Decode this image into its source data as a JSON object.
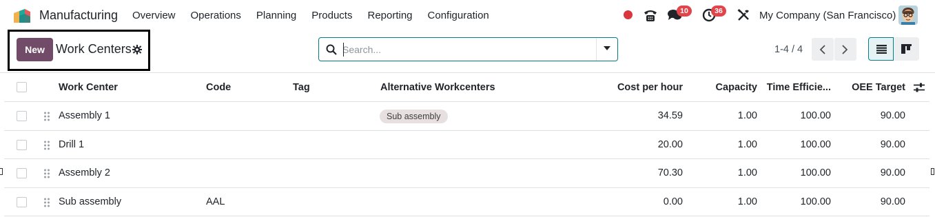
{
  "navbar": {
    "app_name": "Manufacturing",
    "menu": [
      "Overview",
      "Operations",
      "Planning",
      "Products",
      "Reporting",
      "Configuration"
    ],
    "chat_badge": "10",
    "activity_badge": "36",
    "company": "My Company (San Francisco)"
  },
  "control_panel": {
    "new_label": "New",
    "title": "Work Centers",
    "search_placeholder": "Search...",
    "pager": "1-4 / 4"
  },
  "table": {
    "headers": [
      "Work Center",
      "Code",
      "Tag",
      "Alternative Workcenters",
      "Cost per hour",
      "Capacity",
      "Time Efficie...",
      "OEE Target"
    ],
    "rows": [
      {
        "work_center": "Assembly 1",
        "code": "",
        "tag": "",
        "alternative": "Sub assembly",
        "cost": "34.59",
        "capacity": "1.00",
        "efficiency": "100.00",
        "oee": "90.00"
      },
      {
        "work_center": "Drill 1",
        "code": "",
        "tag": "",
        "alternative": "",
        "cost": "20.00",
        "capacity": "1.00",
        "efficiency": "100.00",
        "oee": "90.00"
      },
      {
        "work_center": "Assembly 2",
        "code": "",
        "tag": "",
        "alternative": "",
        "cost": "70.30",
        "capacity": "1.00",
        "efficiency": "100.00",
        "oee": "90.00"
      },
      {
        "work_center": "Sub assembly",
        "code": "AAL",
        "tag": "",
        "alternative": "",
        "cost": "0.00",
        "capacity": "1.00",
        "efficiency": "100.00",
        "oee": "90.00"
      }
    ]
  },
  "colors": {
    "brand": "#714b67",
    "accent": "#017e84",
    "badge": "#e0454b"
  }
}
